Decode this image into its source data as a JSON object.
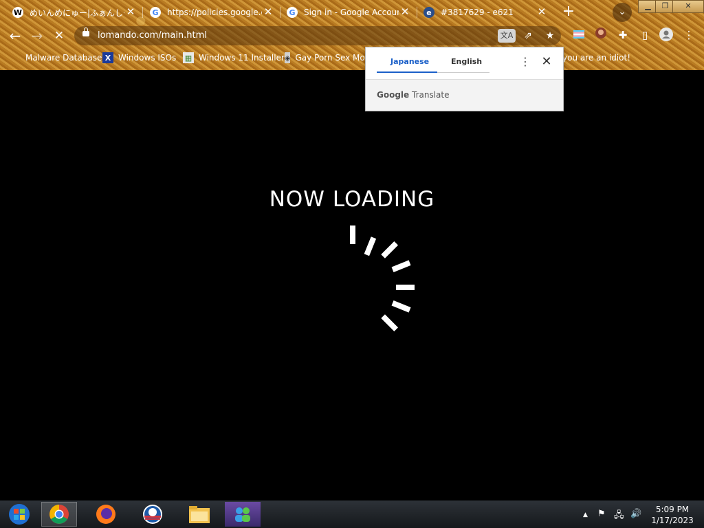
{
  "tabs": [
    {
      "title": "めいんめにゅー|ふぁんしーあいる",
      "favicon": "wikipedia-icon"
    },
    {
      "title": "https://policies.google.com",
      "favicon": "google-g-icon"
    },
    {
      "title": "Sign in - Google Accounts",
      "favicon": "google-g-icon"
    },
    {
      "title": "#3817629 - e621",
      "favicon": "e621-icon"
    }
  ],
  "address_bar": {
    "url": "lomando.com/main.html"
  },
  "bookmarks": [
    {
      "label": "Malware Database"
    },
    {
      "label": "Windows ISOs"
    },
    {
      "label": "Windows 11 Installer"
    },
    {
      "label": "Gay Porn Sex Movi"
    },
    {
      "label": "you are an idiot!"
    }
  ],
  "page": {
    "loading_text": "NOW LOADING"
  },
  "translate_popup": {
    "tab_source": "Japanese",
    "tab_target": "English",
    "brand_google": "Google",
    "brand_translate": "Translate"
  },
  "taskbar": {
    "time": "5:09 PM",
    "date": "1/17/2023"
  },
  "colors": {
    "accent": "#1a5fc8",
    "chrome_bg": "#c48a30"
  }
}
